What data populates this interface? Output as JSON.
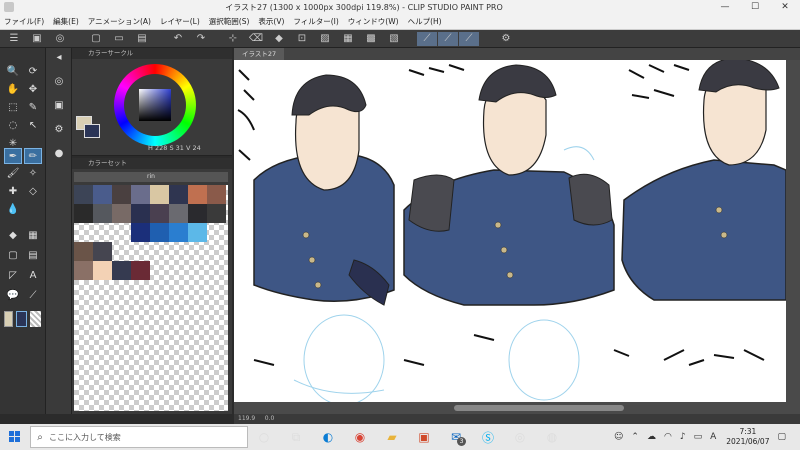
{
  "window": {
    "title": "イラスト27 (1300 x 1000px 300dpi 119.8%) - CLIP STUDIO PAINT PRO",
    "minimize": "—",
    "maximize": "☐",
    "close": "✕"
  },
  "menu": [
    "ファイル(F)",
    "編集(E)",
    "アニメーション(A)",
    "レイヤー(L)",
    "選択範囲(S)",
    "表示(V)",
    "フィルター(I)",
    "ウィンドウ(W)",
    "ヘルプ(H)"
  ],
  "panels": {
    "color_wheel_label": "カラーサークル",
    "color_set_label": "カラーセット",
    "color_set_name": "rin",
    "hsv": {
      "h": "228",
      "s": "31",
      "v": "24"
    }
  },
  "canvas": {
    "tab_label": "イラスト27",
    "zoom_status": "119.9",
    "coord_status": "0.0"
  },
  "taskbar": {
    "search_placeholder": "ここに入力して検索",
    "time": "7:31",
    "date": "2021/06/07",
    "ime": "A",
    "mail_badge": "3"
  },
  "colors": {
    "accent": "#3a6fa0",
    "jacket": "#3e5685",
    "hair": "#3a3a42",
    "line_art_sketch": "#9fd3ec"
  },
  "color_set": {
    "row1": [
      "#3c4456",
      "#4a5c8c",
      "#4a4040",
      "#6a6d8c",
      "#d9c7a3",
      "#2f3550",
      "#c07050",
      "#8a5a4a"
    ],
    "row2": [
      "#2a2a2a",
      "#55585e",
      "#786a66",
      "#2a3050",
      "#4a4050",
      "#6a6a70",
      "#2a2a2e",
      "#3a3a3a"
    ],
    "row3": [
      "",
      "",
      "",
      "#1b2f7a",
      "#1f5fb0",
      "#2a7ed0",
      "#5cb8e8",
      ""
    ],
    "row4": [
      "#6a5448",
      "#454550",
      "",
      "",
      "",
      "",
      "",
      ""
    ],
    "row5": [
      "#8a7066",
      "#f3d2b5",
      "#353a50",
      "#6a2a35",
      "",
      "",
      "",
      ""
    ]
  }
}
